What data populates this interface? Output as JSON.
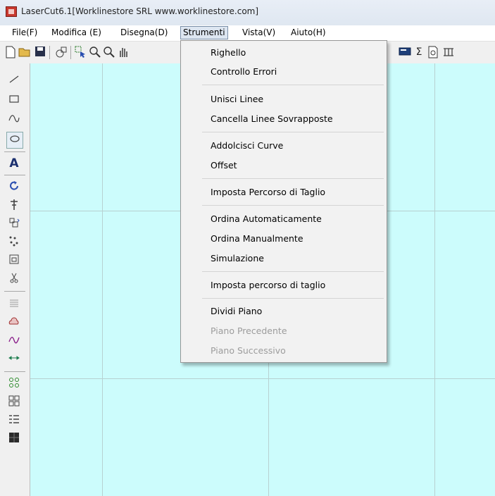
{
  "window": {
    "title": "LaserCut6.1[Worklinestore SRL www.worklinestore.com]"
  },
  "menubar": {
    "items": [
      "File(F)",
      "Modifica (E)",
      "Disegna(D)",
      "Strumenti",
      "Vista(V)",
      "Aiuto(H)"
    ],
    "active": "Strumenti"
  },
  "toolbar": {
    "icons": [
      "new-icon",
      "open-icon",
      "save-icon",
      "connect-icon",
      "select-icon",
      "zoom-in-icon",
      "zoom-icon",
      "pan-icon",
      "display-icon",
      "sum-icon",
      "preview-icon",
      "config-icon"
    ],
    "sum_glyph": "Σ"
  },
  "left_toolbar": {
    "icons": [
      "line-icon",
      "rectangle-icon",
      "curve-icon",
      "ellipse-icon",
      "text-icon",
      "rotate-icon",
      "align-icon",
      "array-icon",
      "dots-icon",
      "crop-icon",
      "scissors-icon",
      "hatch-icon",
      "cloud-icon",
      "wave-icon",
      "measure-icon",
      "group-icon",
      "grid-icon",
      "list-icon",
      "fill-icon"
    ],
    "text_glyph": "A"
  },
  "dropdown": {
    "groups": [
      [
        {
          "label": "Righello",
          "enabled": true
        },
        {
          "label": "Controllo Errori",
          "enabled": true
        }
      ],
      [
        {
          "label": "Unisci Linee",
          "enabled": true
        },
        {
          "label": "Cancella Linee Sovrapposte",
          "enabled": true
        }
      ],
      [
        {
          "label": "Addolcisci Curve",
          "enabled": true
        },
        {
          "label": "Offset",
          "enabled": true
        }
      ],
      [
        {
          "label": "Imposta Percorso di Taglio",
          "enabled": true
        }
      ],
      [
        {
          "label": "Ordina Automaticamente",
          "enabled": true
        },
        {
          "label": "Ordina Manualmente",
          "enabled": true
        },
        {
          "label": "Simulazione",
          "enabled": true
        }
      ],
      [
        {
          "label": "Imposta percorso di taglio",
          "enabled": true
        }
      ],
      [
        {
          "label": "Dividi Piano",
          "enabled": true
        },
        {
          "label": "Piano Precedente",
          "enabled": false
        },
        {
          "label": "Piano Successivo",
          "enabled": false
        }
      ]
    ]
  },
  "canvas": {
    "background": "#ccfcfc"
  }
}
